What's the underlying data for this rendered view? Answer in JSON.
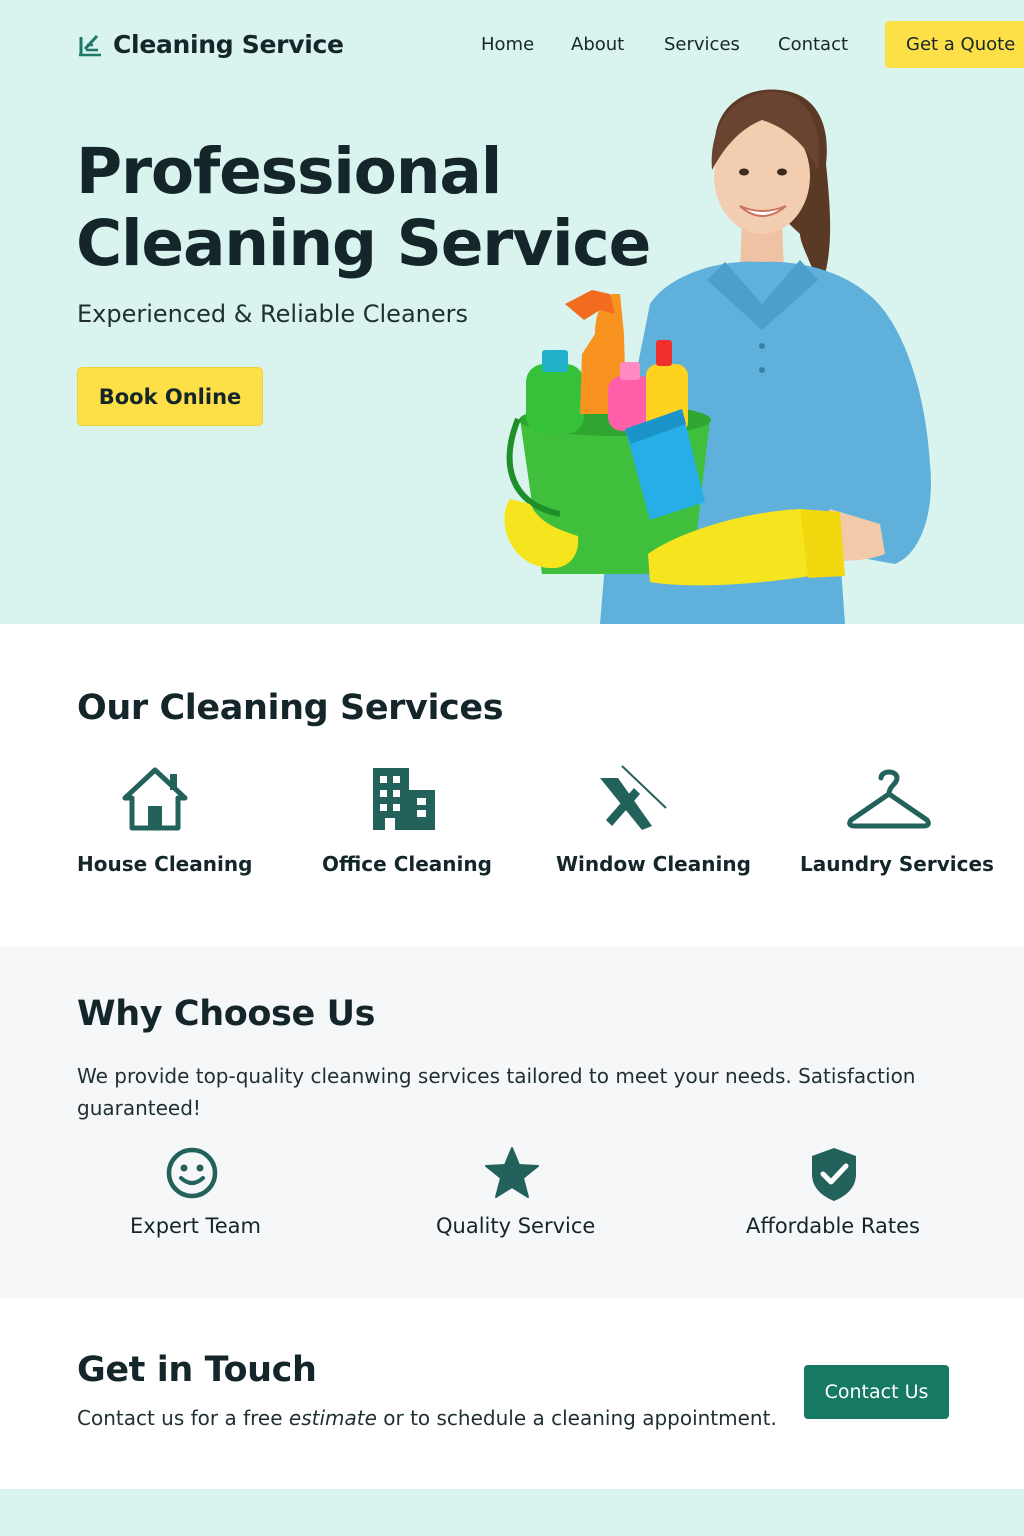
{
  "header": {
    "logo_text": "Cleaning Service",
    "nav": [
      "Home",
      "About",
      "Services",
      "Contact"
    ],
    "cta": "Get a Quote"
  },
  "hero": {
    "title_line1": "Professional",
    "title_line2": "Cleaning Service",
    "subtitle": "Experienced & Reliable Cleaners",
    "button": "Book Online"
  },
  "services": {
    "title": "Our Cleaning Services",
    "items": [
      {
        "label": "House Cleaning",
        "icon": "house-icon"
      },
      {
        "label": "Office Cleaning",
        "icon": "office-building-icon"
      },
      {
        "label": "Window Cleaning",
        "icon": "squeegee-icon"
      },
      {
        "label": "Laundry Services",
        "icon": "hanger-icon"
      }
    ]
  },
  "why": {
    "title": "Why Choose Us",
    "text": "We provide top-quality cleanwing services tailored to meet your needs. Satisfaction guaranteed!",
    "features": [
      {
        "label": "Expert Team",
        "icon": "smiley-icon"
      },
      {
        "label": "Quality Service",
        "icon": "star-icon"
      },
      {
        "label": "Affordable Rates",
        "icon": "shield-check-icon"
      }
    ]
  },
  "contact": {
    "title": "Get in Touch",
    "text_before": "Contact us for a free ",
    "text_em": "estimate",
    "text_after": " or to schedule a cleaning appointment.",
    "button": "Contact Us"
  },
  "colors": {
    "hero_bg": "#d9f3ee",
    "accent_yellow": "#fde047",
    "brand_green": "#157a61",
    "icon_teal": "#23615b",
    "text_dark": "#15262a"
  }
}
